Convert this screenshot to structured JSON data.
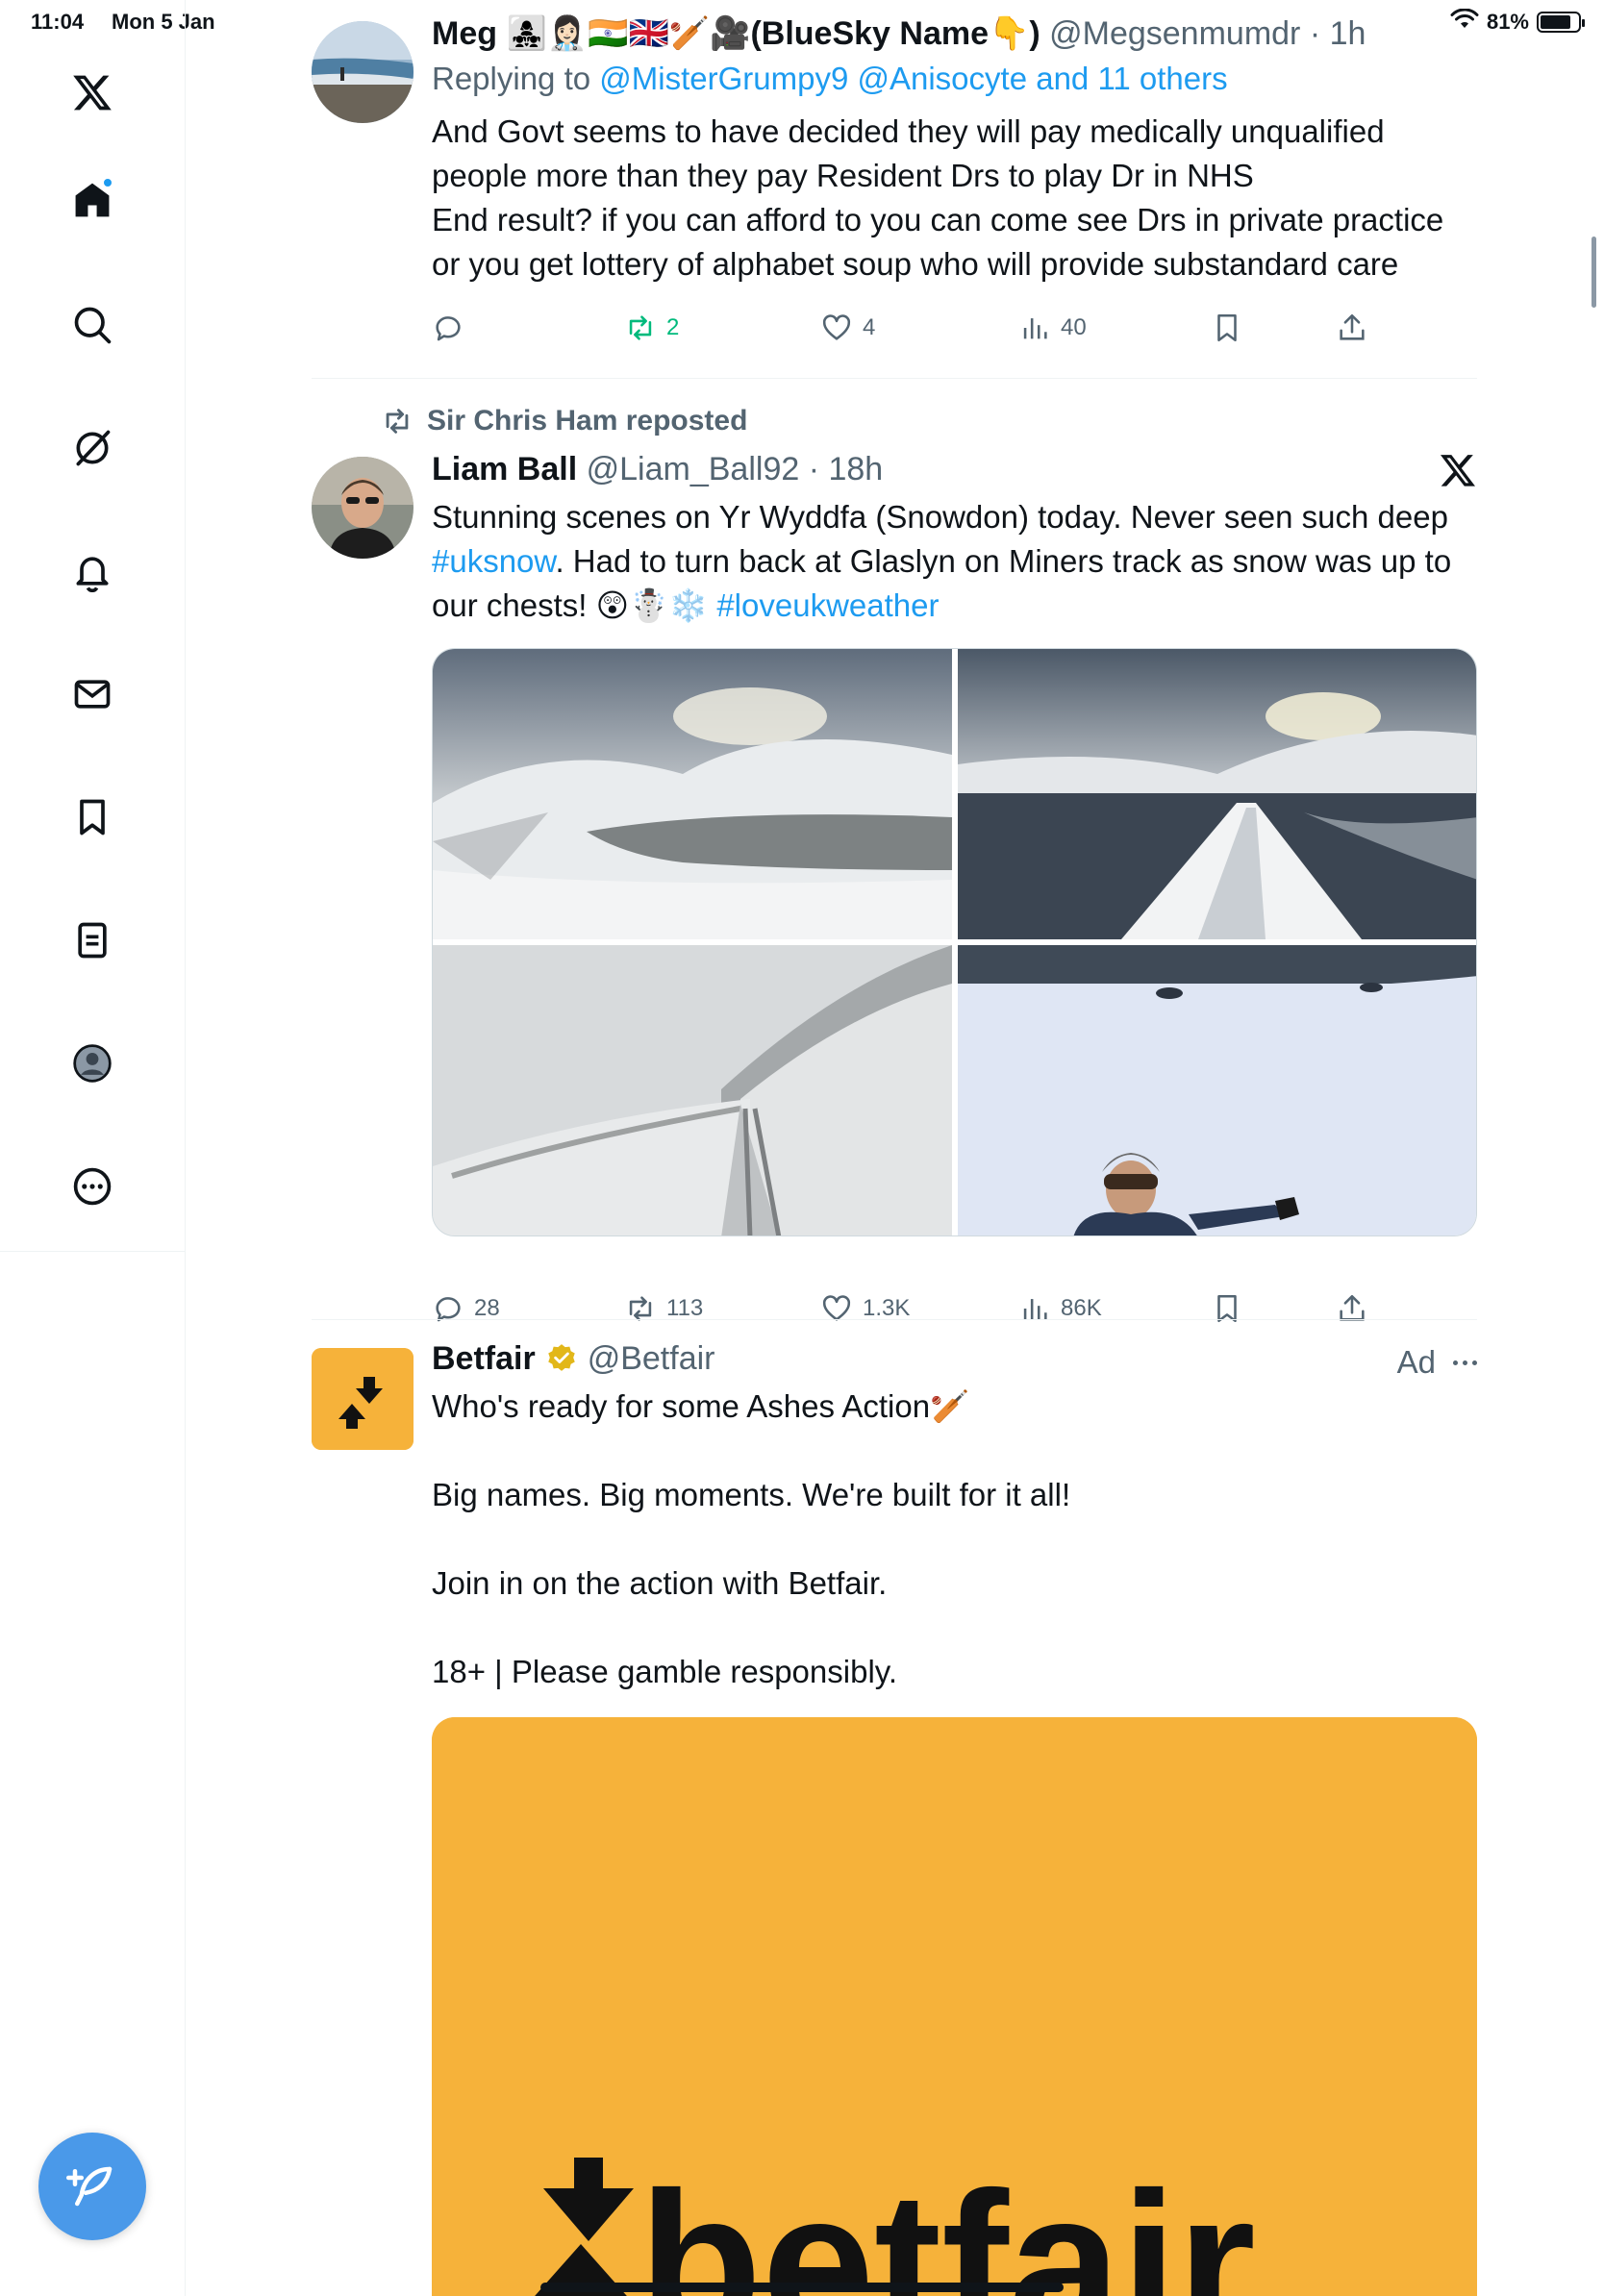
{
  "status_bar": {
    "time": "11:04",
    "date": "Mon 5 Jan",
    "battery": "81%",
    "battery_level": 0.81
  },
  "sidebar": {
    "items": [
      {
        "icon": "x-logo-icon"
      },
      {
        "icon": "home-icon",
        "active": true,
        "has_notification": true
      },
      {
        "icon": "search-icon"
      },
      {
        "icon": "grok-icon"
      },
      {
        "icon": "notifications-icon"
      },
      {
        "icon": "messages-icon"
      },
      {
        "icon": "bookmarks-icon"
      },
      {
        "icon": "lists-icon"
      },
      {
        "icon": "profile-icon"
      },
      {
        "icon": "more-icon"
      }
    ],
    "compose_icon": "compose-icon"
  },
  "tweets": [
    {
      "author_name": "Meg 👩‍👧‍👧👩🏻‍⚕️🇮🇳🇬🇧🏏🎥(BlueSky Name👇)",
      "handle": "@Megsenmumdr",
      "time": "· 1h",
      "replying_label": "Replying to",
      "replying_handles": "@MisterGrumpy9 @Anisocyte and 11 others",
      "text": "And Govt seems to have decided they will pay medically unqualified people more than they pay Resident Drs to play Dr in NHS\nEnd result? if you can afford to you can come see Drs in private practice or you get lottery of alphabet soup who will provide substandard care",
      "stats": {
        "replies": "",
        "reposts": "2",
        "likes": "4",
        "views": "40"
      }
    },
    {
      "repost_label": "Sir Chris Ham reposted",
      "author_name": "Liam Ball",
      "handle": "@Liam_Ball92",
      "time": "· 18h",
      "text_parts": [
        {
          "t": "Stunning scenes on Yr Wyddfa (Snowdon) today. Never seen such deep "
        },
        {
          "t": "#uksnow",
          "link": true
        },
        {
          "t": ". Had to turn back at Glaslyn on Miners track as snow was up to our chests! 😲☃️❄️ "
        },
        {
          "t": "#loveukweather",
          "link": true
        }
      ],
      "stats": {
        "replies": "28",
        "reposts": "113",
        "likes": "1.3K",
        "views": "86K"
      }
    },
    {
      "author_name": "Betfair",
      "verified": true,
      "handle": "@Betfair",
      "ad_label": "Ad",
      "text_lines": [
        "Who's ready for some Ashes Action🏏",
        "Big names. Big moments. We're built for it all!",
        "Join in on the action with Betfair.",
        "18+ | Please gamble responsibly."
      ],
      "card_wordmark": "betfair",
      "card_color": "#f6b23a"
    }
  ]
}
